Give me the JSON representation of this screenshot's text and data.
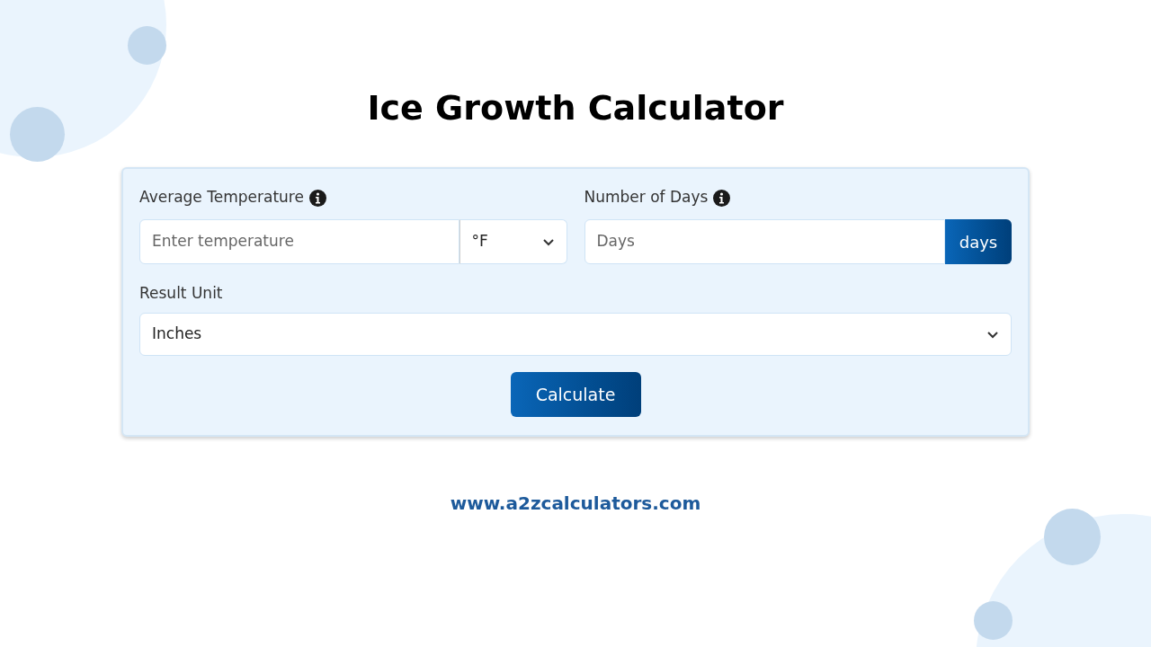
{
  "title": "Ice Growth Calculator",
  "fields": [
    {
      "label": "Average Temperature",
      "placeholder": "Enter temperature",
      "kind": "select",
      "addon": "°F"
    },
    {
      "label": "Number of Days",
      "placeholder": "Days",
      "kind": "button",
      "addon": "days"
    }
  ],
  "result_unit": {
    "label": "Result Unit",
    "value": "Inches"
  },
  "button": "Calculate",
  "website": "www.a2zcalculators.com"
}
